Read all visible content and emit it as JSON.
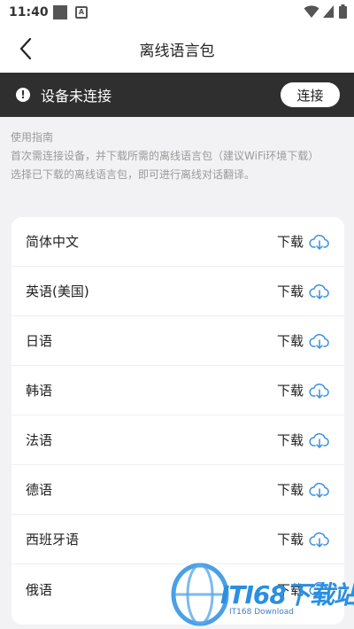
{
  "status_bar": {
    "time": "11:40",
    "notification_letter": "A"
  },
  "header": {
    "title": "离线语言包"
  },
  "banner": {
    "message": "设备未连接",
    "alert_symbol": "!",
    "connect_label": "连接"
  },
  "guide": {
    "heading": "使用指南",
    "step1": "首次需连接设备，并下载所需的离线语言包（建议WiFi环境下载）",
    "step2": "选择已下载的离线语言包，即可进行离线对话翻译。"
  },
  "languages": [
    {
      "name": "简体中文",
      "action": "下载"
    },
    {
      "name": "英语(美国)",
      "action": "下载"
    },
    {
      "name": "日语",
      "action": "下载"
    },
    {
      "name": "韩语",
      "action": "下载"
    },
    {
      "name": "法语",
      "action": "下载"
    },
    {
      "name": "德语",
      "action": "下载"
    },
    {
      "name": "西班牙语",
      "action": "下载"
    },
    {
      "name": "俄语",
      "action": "下载"
    }
  ],
  "watermark": {
    "brand": "ITI68下载站",
    "sub": "IT168 Download"
  },
  "colors": {
    "banner_bg": "#2f2f2f",
    "accent_blue": "#3c8fe0",
    "page_bg": "#f2f2f4"
  }
}
